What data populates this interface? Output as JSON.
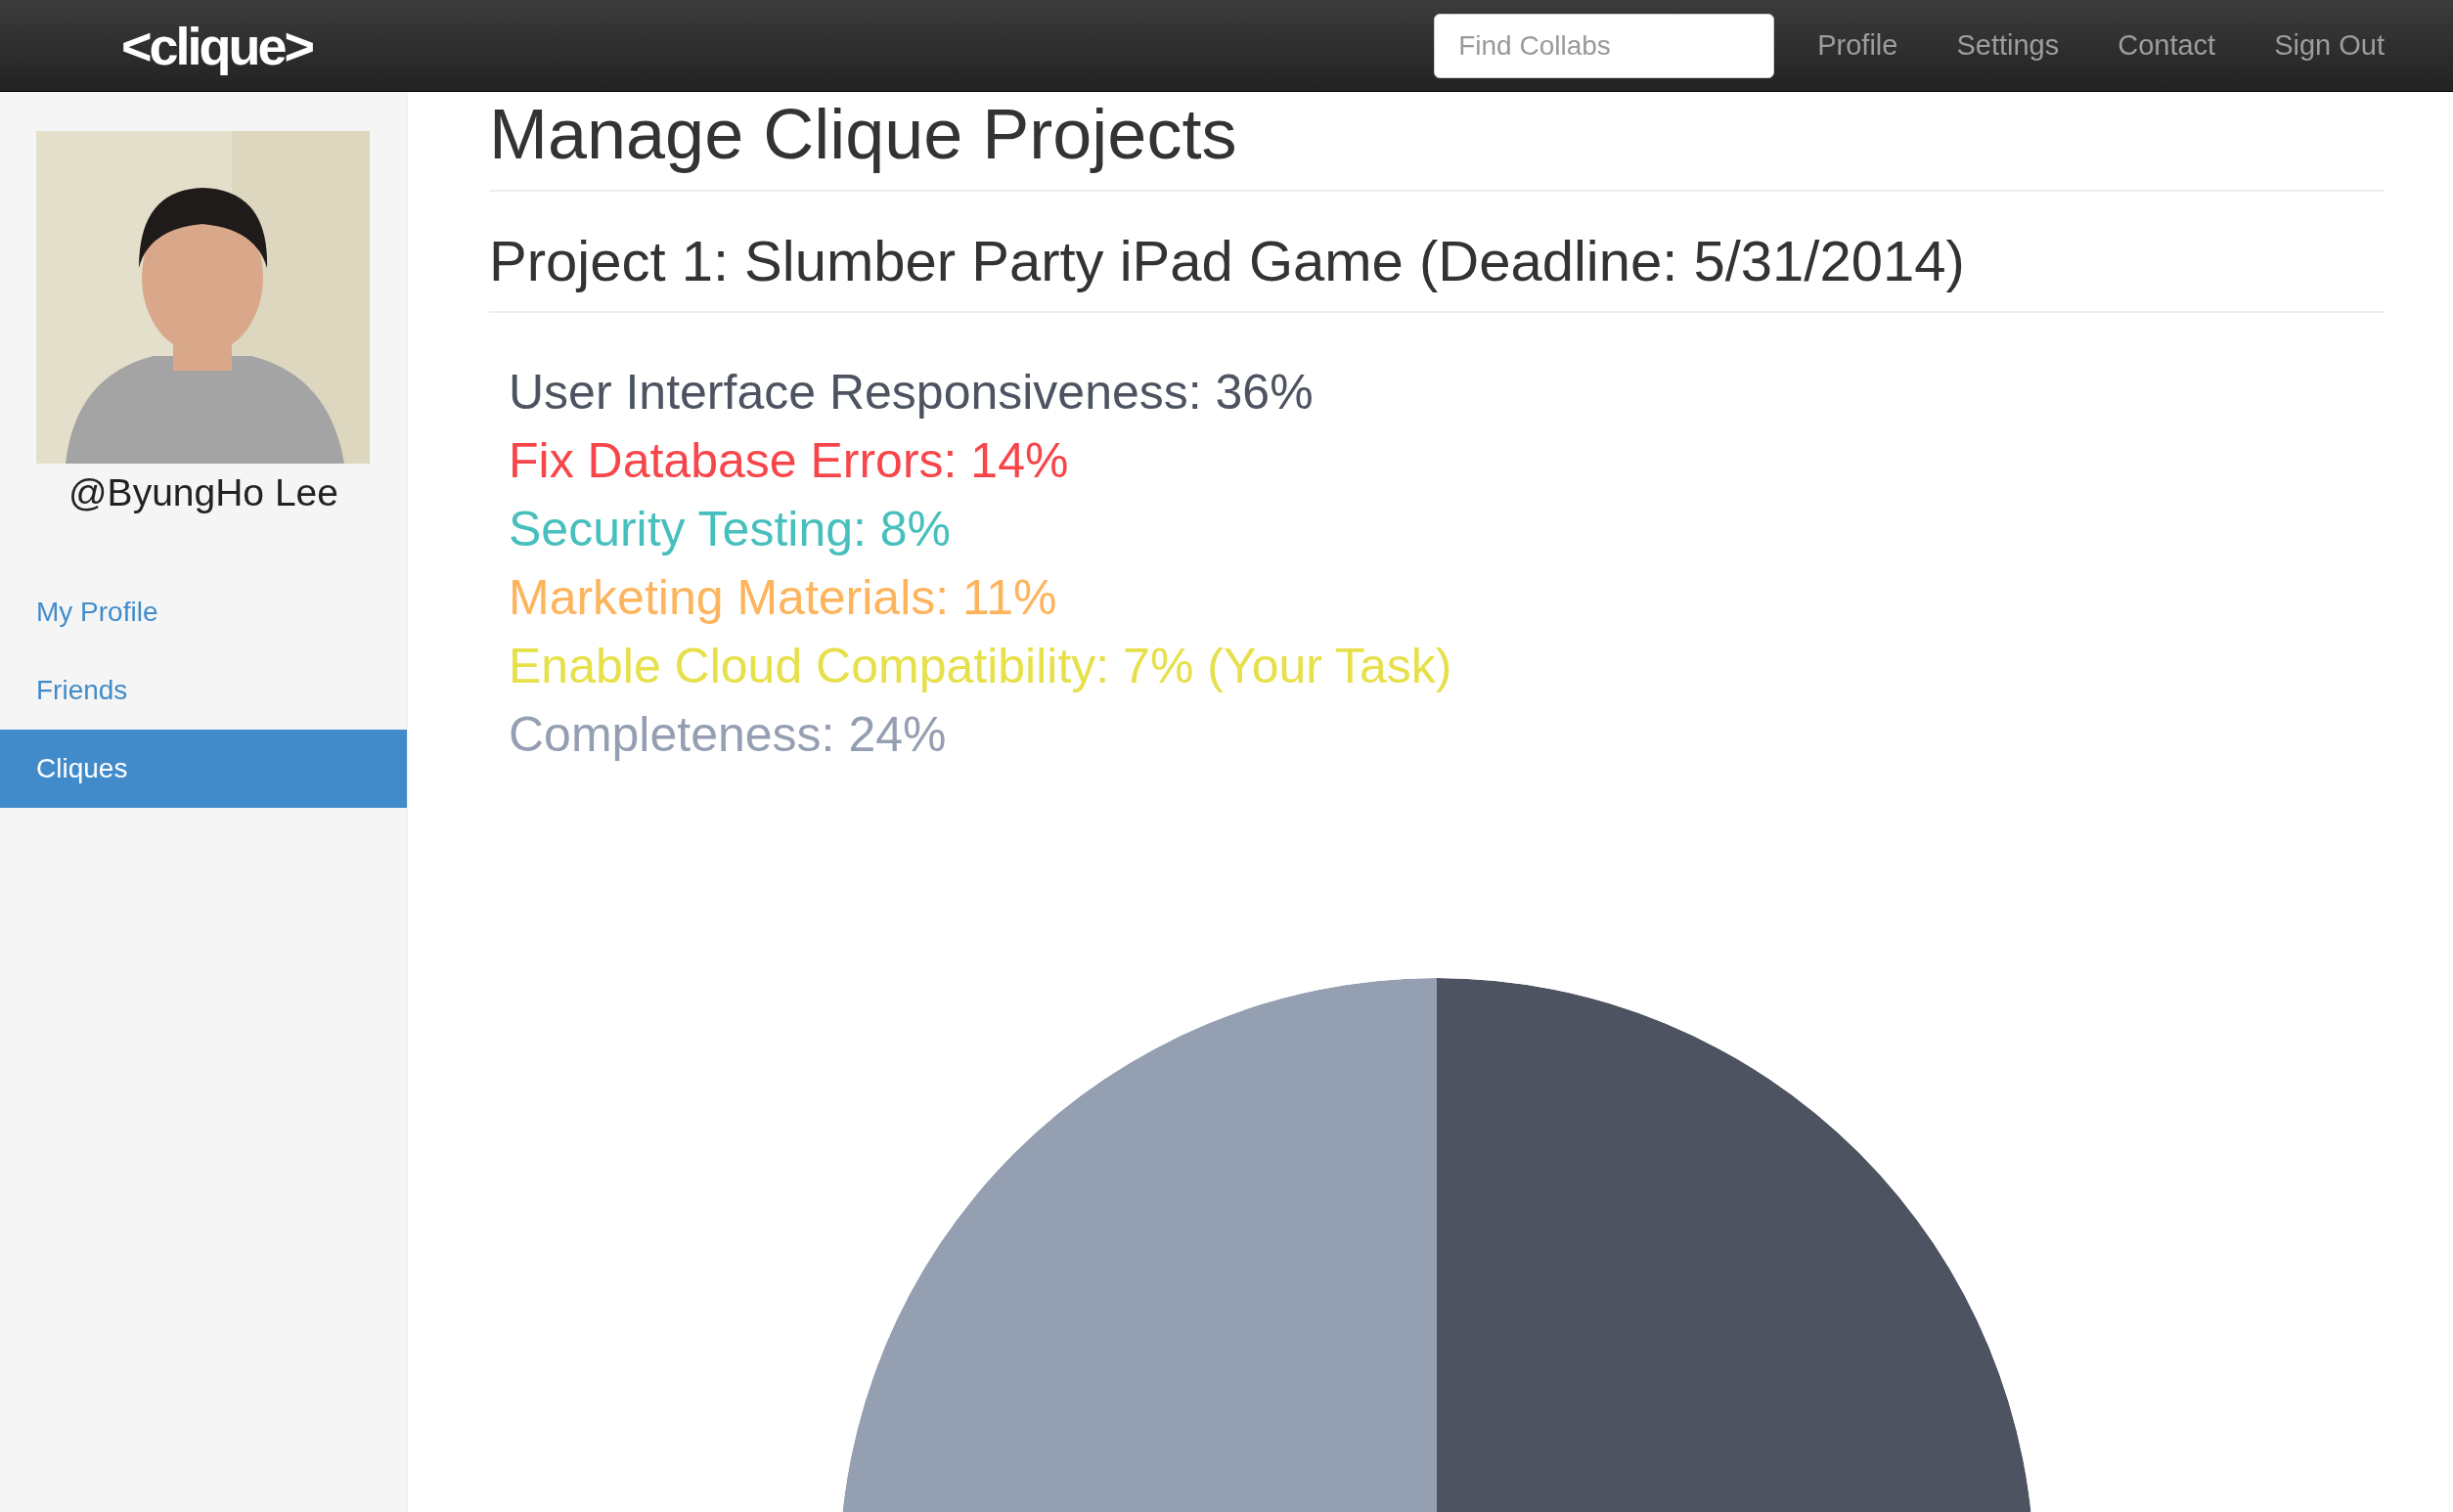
{
  "navbar": {
    "logo": "<clique>",
    "search": {
      "placeholder": "Find Collabs"
    },
    "links": [
      "Profile",
      "Settings",
      "Contact",
      "Sign Out"
    ]
  },
  "sidebar": {
    "username": "@ByungHo Lee",
    "items": [
      {
        "label": "My Profile",
        "selected": false
      },
      {
        "label": "Friends",
        "selected": false
      },
      {
        "label": "Cliques",
        "selected": true
      }
    ]
  },
  "main": {
    "title": "Manage Clique Projects",
    "project_title": "Project 1: Slumber Party iPad Game (Deadline: 5/31/2014)",
    "legend": [
      {
        "label": "User Interface Responsiveness: 36%",
        "color": "#4d5360"
      },
      {
        "label": "Fix Database Errors: 14%",
        "color": "#f7464a"
      },
      {
        "label": "Security Testing: 8%",
        "color": "#46bfbd"
      },
      {
        "label": "Marketing Materials: 11%",
        "color": "#fdb45c"
      },
      {
        "label": "Enable Cloud Compatibility: 7% (Your Task)",
        "color": "#e6e04a"
      },
      {
        "label": "Completeness: 24%",
        "color": "#949fb1"
      }
    ]
  }
}
